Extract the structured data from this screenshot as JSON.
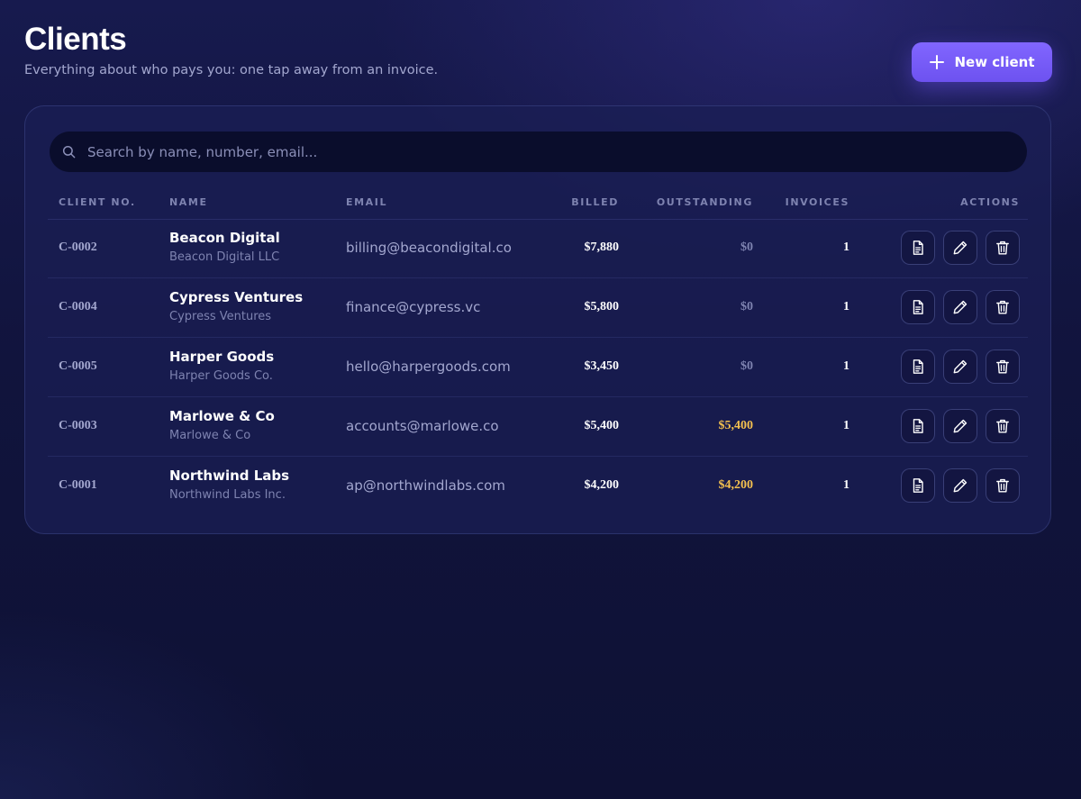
{
  "header": {
    "title": "Clients",
    "subtitle": "Everything about who pays you: one tap away from an invoice.",
    "new_client_label": "New client"
  },
  "search": {
    "placeholder": "Search by name, number, email...",
    "value": ""
  },
  "table": {
    "columns": {
      "client_no": "CLIENT NO.",
      "name": "NAME",
      "email": "EMAIL",
      "billed": "BILLED",
      "outstanding": "OUTSTANDING",
      "invoices": "INVOICES",
      "actions": "ACTIONS"
    },
    "rows": [
      {
        "client_no": "C-0002",
        "name": "Beacon Digital",
        "company": "Beacon Digital LLC",
        "email": "billing@beacondigital.co",
        "billed": "$7,880",
        "outstanding": "$0",
        "invoices": "1"
      },
      {
        "client_no": "C-0004",
        "name": "Cypress Ventures",
        "company": "Cypress Ventures",
        "email": "finance@cypress.vc",
        "billed": "$5,800",
        "outstanding": "$0",
        "invoices": "1"
      },
      {
        "client_no": "C-0005",
        "name": "Harper Goods",
        "company": "Harper Goods Co.",
        "email": "hello@harpergoods.com",
        "billed": "$3,450",
        "outstanding": "$0",
        "invoices": "1"
      },
      {
        "client_no": "C-0003",
        "name": "Marlowe & Co",
        "company": "Marlowe & Co",
        "email": "accounts@marlowe.co",
        "billed": "$5,400",
        "outstanding": "$5,400",
        "invoices": "1"
      },
      {
        "client_no": "C-0001",
        "name": "Northwind Labs",
        "company": "Northwind Labs Inc.",
        "email": "ap@northwindlabs.com",
        "billed": "$4,200",
        "outstanding": "$4,200",
        "invoices": "1"
      }
    ],
    "row_actions": [
      "document-icon",
      "pencil-icon",
      "trash-icon"
    ]
  },
  "colors": {
    "accent": "#7c5cff",
    "outstanding_due": "#f3c04f",
    "muted": "#7e83b0"
  }
}
